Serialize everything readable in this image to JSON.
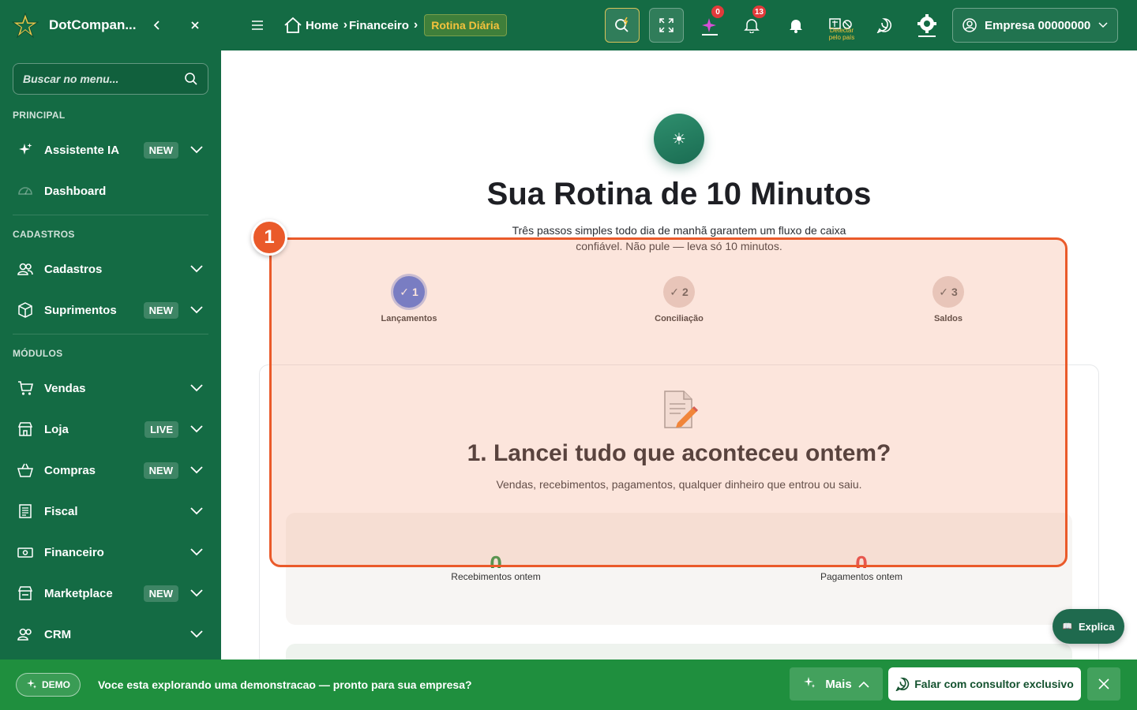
{
  "sidebar": {
    "brand": "DotCompan...",
    "search_placeholder": "Buscar no menu...",
    "sections": {
      "principal": "PRINCIPAL",
      "cadastros": "CADASTROS",
      "modulos": "MÓDULOS"
    },
    "items": [
      {
        "label": "Assistente IA",
        "badge": "NEW",
        "icon": "sparkle-icon"
      },
      {
        "label": "Dashboard",
        "badge": "",
        "icon": "gauge-icon"
      },
      {
        "label": "Cadastros",
        "badge": "",
        "icon": "users-icon"
      },
      {
        "label": "Suprimentos",
        "badge": "NEW",
        "icon": "box-icon"
      },
      {
        "label": "Vendas",
        "badge": "",
        "icon": "cart-icon"
      },
      {
        "label": "Loja",
        "badge": "LIVE",
        "icon": "store-icon"
      },
      {
        "label": "Compras",
        "badge": "NEW",
        "icon": "basket-icon"
      },
      {
        "label": "Fiscal",
        "badge": "",
        "icon": "receipt-icon"
      },
      {
        "label": "Financeiro",
        "badge": "",
        "icon": "money-icon"
      },
      {
        "label": "Marketplace",
        "badge": "NEW",
        "icon": "marketplace-icon"
      },
      {
        "label": "CRM",
        "badge": "",
        "icon": "crm-icon"
      }
    ]
  },
  "topbar": {
    "breadcrumb": [
      "Home",
      "Financeiro",
      "Rotina Diária"
    ],
    "sparkle_count": "0",
    "notification_count": "13",
    "geo_label": "Detectar pelo país",
    "company": "Empresa 00000000",
    "colors": {
      "accent": "#146b44",
      "highlight": "#f4c23c"
    }
  },
  "main": {
    "title": "Sua Rotina de 10 Minutos",
    "subtitle": "Três passos simples todo dia de manhã garantem um fluxo de caixa confiável. Não pule — leva só 10 minutos.",
    "steps": [
      {
        "num": "1",
        "label": "Lançamentos",
        "active": true
      },
      {
        "num": "2",
        "label": "Conciliação",
        "active": false
      },
      {
        "num": "3",
        "label": "Saldos",
        "active": false
      }
    ],
    "card_title": "1. Lancei tudo que aconteceu ontem?",
    "card_desc": "Vendas, recebimentos, pagamentos, qualquer dinheiro que entrou ou saiu.",
    "stats": [
      {
        "value": "0",
        "label": "Recebimentos ontem",
        "color": "#1f8f3e"
      },
      {
        "value": "0",
        "label": "Pagamentos ontem",
        "color": "#e23b3b"
      }
    ],
    "highlight_number": "1",
    "explica": "Explica"
  },
  "bottombar": {
    "demo": "DEMO",
    "msg_pre": "Voce esta explorando uma ",
    "msg_bold": "demonstracao",
    "msg_post": " — pronto para sua empresa?",
    "mais": "Mais",
    "falar": "Falar com consultor exclusivo"
  }
}
